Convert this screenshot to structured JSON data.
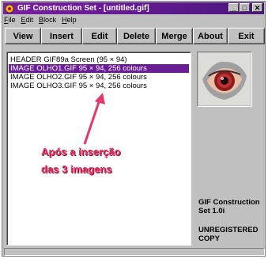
{
  "window": {
    "title": "GIF Construction Set - [untitled.gif]",
    "controls": {
      "minimize": "_",
      "maximize": "□",
      "close": "✕"
    }
  },
  "menu": [
    "File",
    "Edit",
    "Block",
    "Help"
  ],
  "toolbar": [
    "View",
    "Insert",
    "Edit",
    "Delete",
    "Merge",
    "About",
    "Exit"
  ],
  "list": [
    "HEADER GIF89a Screen (95 × 94)",
    "IMAGE OLHO1.GIF 95 × 94, 256 colours",
    "IMAGE OLHO2.GIF 95 × 94, 256 colours",
    "IMAGE OLHO3.GIF 95 × 94, 256 colours"
  ],
  "selected_index": 1,
  "annotation": {
    "line1": "Após a inserção",
    "line2": "das 3 imagens",
    "color": "#e9356a"
  },
  "info": {
    "product_line1": "GIF Construction",
    "product_line2": "Set 1.0i",
    "reg_line1": "UNREGISTERED",
    "reg_line2": "COPY"
  },
  "colors": {
    "titlebar": "#6a1e96",
    "selection": "#6a1e96",
    "face": "#c0c0c0"
  },
  "icons": {
    "app": "gif-app-icon",
    "preview": "eye-image"
  }
}
